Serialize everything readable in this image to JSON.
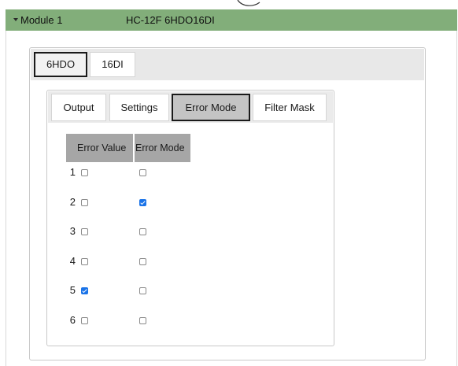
{
  "module": {
    "name": "Module 1",
    "model": "HC-12F 6HDO16DI"
  },
  "module_tabs": [
    {
      "label": "6HDO",
      "active": true
    },
    {
      "label": "16DI",
      "active": false
    }
  ],
  "sub_tabs": [
    {
      "label": "Output",
      "active": false
    },
    {
      "label": "Settings",
      "active": false
    },
    {
      "label": "Error Mode",
      "active": true
    },
    {
      "label": "Filter Mask",
      "active": false
    }
  ],
  "table": {
    "headers": [
      "Error Value",
      "Error Mode"
    ],
    "rows": [
      {
        "num": "1",
        "error_value": false,
        "error_mode": false
      },
      {
        "num": "2",
        "error_value": false,
        "error_mode": true
      },
      {
        "num": "3",
        "error_value": false,
        "error_mode": false
      },
      {
        "num": "4",
        "error_value": false,
        "error_mode": false
      },
      {
        "num": "5",
        "error_value": true,
        "error_mode": false
      },
      {
        "num": "6",
        "error_value": false,
        "error_mode": false
      }
    ]
  },
  "colors": {
    "header_green": "#82ae7a",
    "checked_blue": "#1a73e8",
    "table_header": "#a6a6a6"
  }
}
